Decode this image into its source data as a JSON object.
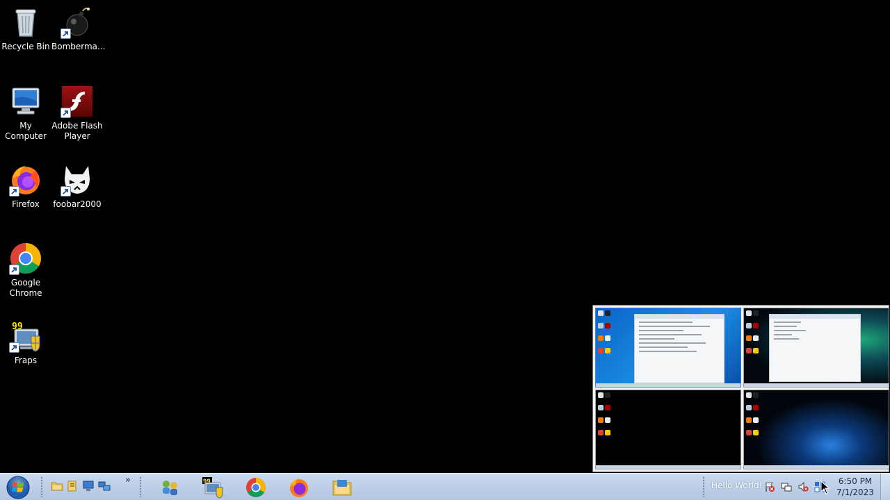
{
  "desktop": {
    "icons": [
      {
        "label": "Recycle Bin",
        "icon": "recycle-bin-icon"
      },
      {
        "label": "Bomberma...",
        "icon": "bomb-icon"
      },
      {
        "label": "My Computer",
        "icon": "computer-icon"
      },
      {
        "label": "Adobe Flash Player",
        "icon": "flash-icon"
      },
      {
        "label": "Firefox",
        "icon": "firefox-icon"
      },
      {
        "label": "foobar2000",
        "icon": "foobar-icon"
      },
      {
        "label": "Google Chrome",
        "icon": "chrome-icon"
      },
      {
        "label": "Fraps",
        "icon": "fraps-icon"
      }
    ]
  },
  "workspace_switcher": {
    "workspaces": [
      {
        "name": "workspace-1",
        "active": true
      },
      {
        "name": "workspace-2",
        "active": false
      },
      {
        "name": "workspace-3",
        "active": false
      },
      {
        "name": "workspace-4",
        "active": false
      }
    ]
  },
  "taskbar": {
    "quick_launch_more": "»",
    "pinned": [
      "network-people-icon",
      "fraps-icon",
      "chrome-icon",
      "firefox-icon",
      "explorer-icon"
    ],
    "tray": {
      "message": "Hello World!",
      "icons": [
        "flag-icon",
        "network-icon",
        "volume-muted-icon",
        "workspace-icon"
      ]
    },
    "clock": {
      "time": "6:50 PM",
      "date": "7/1/2023"
    }
  },
  "colors": {
    "desktop_bg": "#000000",
    "taskbar_top": "#c9d9ee",
    "taskbar_bottom": "#b3c6e0",
    "switcher_active_border": "#3c7fe0"
  }
}
